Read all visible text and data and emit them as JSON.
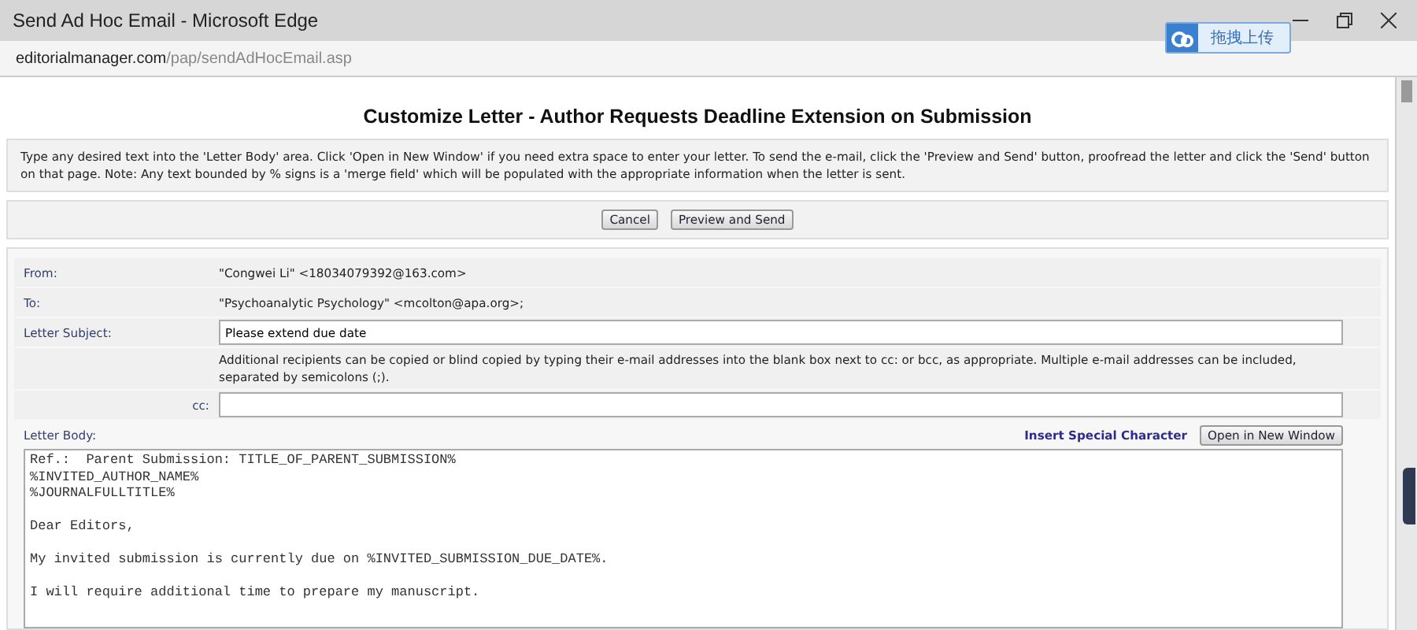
{
  "window": {
    "title": "Send Ad Hoc Email - Microsoft Edge"
  },
  "address": {
    "host": "editorialmanager.com",
    "path": "/pap/sendAdHocEmail.asp"
  },
  "upload_widget": {
    "label": "拖拽上传"
  },
  "heading": "Customize Letter - Author Requests Deadline Extension on Submission",
  "instructions": "Type any desired text into the 'Letter Body' area. Click 'Open in New Window' if you need extra space to enter your letter. To send the e-mail, click the 'Preview and Send' button, proofread the letter and click the 'Send' button on that page. Note: Any text bounded by % signs is a 'merge field' which will be populated with the appropriate information when the letter is sent.",
  "buttons": [
    "Cancel",
    "Preview and Send"
  ],
  "form": {
    "from_label": "From:",
    "from": "\"Congwei Li\" <18034079392@163.com>",
    "to_label": "To:",
    "to": "\"Psychoanalytic Psychology\" <mcolton@apa.org>;",
    "subject_label": "Letter Subject:",
    "subject": "Please extend due date",
    "note": "Additional recipients can be copied or blind copied by typing their e-mail addresses into the blank box next to cc: or bcc, as appropriate. Multiple e-mail addresses can be included, separated by semicolons (;).",
    "cc_label": "cc:",
    "body_label": "Letter Body:",
    "insert_link": "Insert Special Character",
    "open_button": "Open in New Window",
    "body": "Ref.:  Parent Submission: TITLE_OF_PARENT_SUBMISSION%\n%INVITED_AUTHOR_NAME%\n%JOURNALFULLTITLE%\n\nDear Editors,\n\nMy invited submission is currently due on %INVITED_SUBMISSION_DUE_DATE%.\n\nI will require additional time to prepare my manuscript."
  }
}
